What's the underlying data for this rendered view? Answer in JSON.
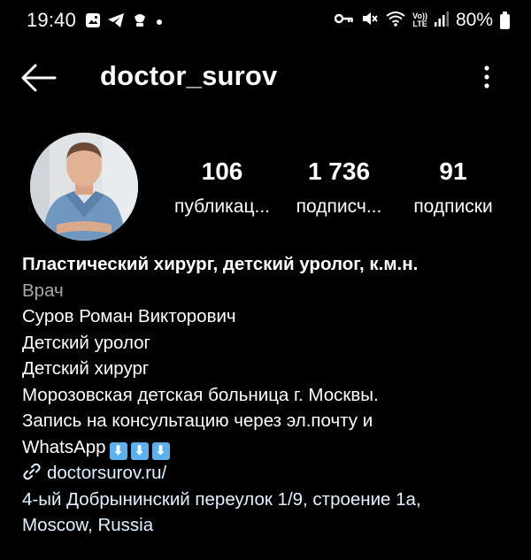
{
  "status_bar": {
    "time": "19:40",
    "left_icons": [
      "gallery-icon",
      "telegram-icon",
      "pin-icon",
      "dot-icon"
    ],
    "right_icons": [
      "key-icon",
      "mute-icon",
      "wifi-icon",
      "volte-icon",
      "signal-icon"
    ],
    "volte_top": "Vo))",
    "volte_bottom": "LTE",
    "battery": "80%"
  },
  "header": {
    "username": "doctor_surov"
  },
  "stats": [
    {
      "value": "106",
      "label": "публикац..."
    },
    {
      "value": "1 736",
      "label": "подписч..."
    },
    {
      "value": "91",
      "label": "подписки"
    }
  ],
  "bio": {
    "name": "Пластический хирург, детский уролог, к.м.н.",
    "category": "Врач",
    "lines": [
      "Суров Роман Викторович",
      "Детский уролог",
      "Детский хирург",
      "Морозовская детская больница г. Москвы.",
      "Запись на консультацию через эл.почту и"
    ],
    "last_line": "WhatsApp",
    "arrows": [
      "⬇",
      "⬇",
      "⬇"
    ],
    "link": "doctorsurov.ru/",
    "address_line1": "4-ый Добрынинский переулок 1/9, строение 1а,",
    "address_line2": "Moscow, Russia"
  }
}
